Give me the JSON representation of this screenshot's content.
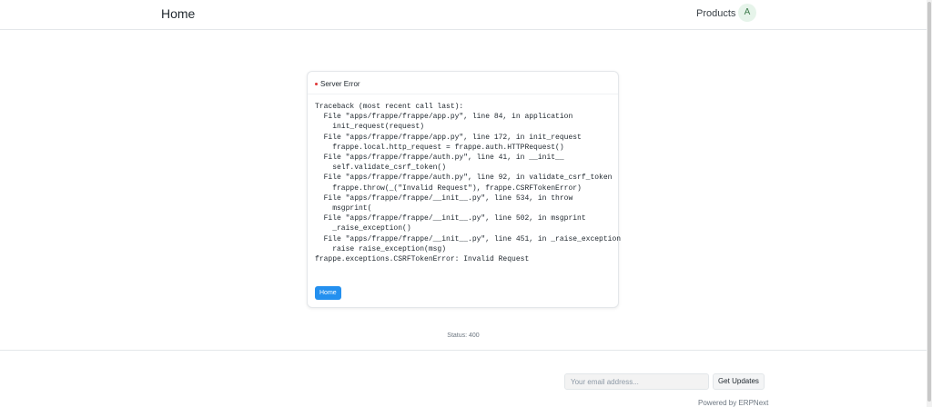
{
  "navbar": {
    "brand": "Home",
    "products_link": "Products",
    "avatar_initial": "A"
  },
  "error_card": {
    "title": "Server Error",
    "indicator_color": "#e03636",
    "traceback": "Traceback (most recent call last):\n  File \"apps/frappe/frappe/app.py\", line 84, in application\n    init_request(request)\n  File \"apps/frappe/frappe/app.py\", line 172, in init_request\n    frappe.local.http_request = frappe.auth.HTTPRequest()\n  File \"apps/frappe/frappe/auth.py\", line 41, in __init__\n    self.validate_csrf_token()\n  File \"apps/frappe/frappe/auth.py\", line 92, in validate_csrf_token\n    frappe.throw(_(\"Invalid Request\"), frappe.CSRFTokenError)\n  File \"apps/frappe/frappe/__init__.py\", line 534, in throw\n    msgprint(\n  File \"apps/frappe/frappe/__init__.py\", line 502, in msgprint\n    _raise_exception()\n  File \"apps/frappe/frappe/__init__.py\", line 451, in _raise_exception\n    raise raise_exception(msg)\nfrappe.exceptions.CSRFTokenError: Invalid Request",
    "home_button": "Home",
    "button_color": "#2490ef"
  },
  "status": "Status: 400",
  "footer": {
    "email_placeholder": "Your email address...",
    "email_value": "",
    "get_updates_button": "Get Updates",
    "powered_by": "Powered by ERPNext"
  }
}
